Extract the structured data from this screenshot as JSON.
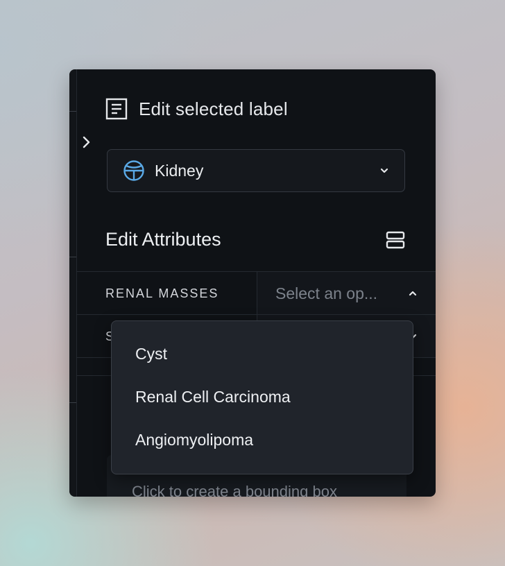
{
  "panel": {
    "title": "Edit selected label",
    "label_select": {
      "value": "Kidney",
      "icon": "globe-icon"
    },
    "attributes_heading": "Edit Attributes",
    "attributes": [
      {
        "label": "RENAL MASSES",
        "placeholder": "Select an op..."
      },
      {
        "label": "S",
        "placeholder": ""
      }
    ],
    "bounding_box_hint": "Click to create a bounding box"
  },
  "dropdown": {
    "options": [
      "Cyst",
      "Renal Cell Carcinoma",
      "Angiomyolipoma"
    ]
  },
  "colors": {
    "panel_bg": "#0f1216",
    "dropdown_bg": "#20242b",
    "accent_icon": "#5aa9e6"
  }
}
